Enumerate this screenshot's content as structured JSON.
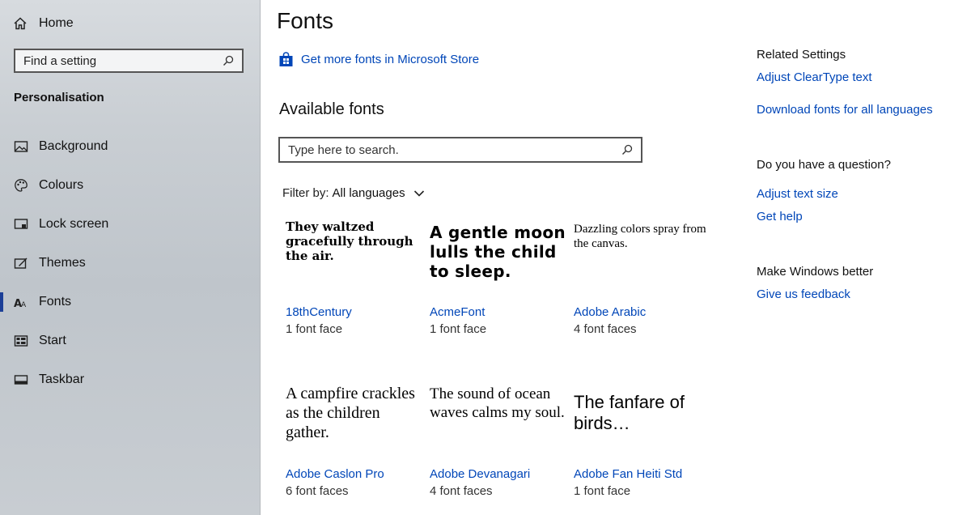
{
  "sidebar": {
    "home_label": "Home",
    "search_placeholder": "Find a setting",
    "section_title": "Personalisation",
    "items": [
      {
        "label": "Background",
        "icon": "picture-icon"
      },
      {
        "label": "Colours",
        "icon": "palette-icon"
      },
      {
        "label": "Lock screen",
        "icon": "lock-screen-icon"
      },
      {
        "label": "Themes",
        "icon": "themes-icon"
      },
      {
        "label": "Fonts",
        "icon": "fonts-icon",
        "active": true
      },
      {
        "label": "Start",
        "icon": "start-icon"
      },
      {
        "label": "Taskbar",
        "icon": "taskbar-icon"
      }
    ],
    "accent_color": "#1c3f97"
  },
  "main": {
    "title": "Fonts",
    "store_link": "Get more fonts in Microsoft Store",
    "available_title": "Available fonts",
    "search_placeholder": "Type here to search.",
    "filter_label": "Filter by:",
    "filter_value": "All languages",
    "fonts": [
      {
        "sample": "They waltzed gracefully through the air.",
        "name": "18thCentury",
        "faces": "1 font face"
      },
      {
        "sample": "A gentle moon lulls the child to sleep.",
        "name": "AcmeFont",
        "faces": "1 font face"
      },
      {
        "sample": "Dazzling colors spray from the canvas.",
        "name": "Adobe Arabic",
        "faces": "4 font faces"
      },
      {
        "sample": "A campfire crackles as the children gather.",
        "name": "Adobe Caslon Pro",
        "faces": "6 font faces"
      },
      {
        "sample": "The sound of ocean waves calms my soul.",
        "name": "Adobe Devanagari",
        "faces": "4 font faces"
      },
      {
        "sample": "The fanfare of birds…",
        "name": "Adobe Fan Heiti Std",
        "faces": "1 font face"
      }
    ],
    "link_color": "#0046b8"
  },
  "related": {
    "heading": "Related Settings",
    "links": [
      "Adjust ClearType text",
      "Download fonts for all languages"
    ],
    "question_heading": "Do you have a question?",
    "question_links": [
      "Adjust text size",
      "Get help"
    ],
    "better_heading": "Make Windows better",
    "better_link": "Give us feedback"
  }
}
